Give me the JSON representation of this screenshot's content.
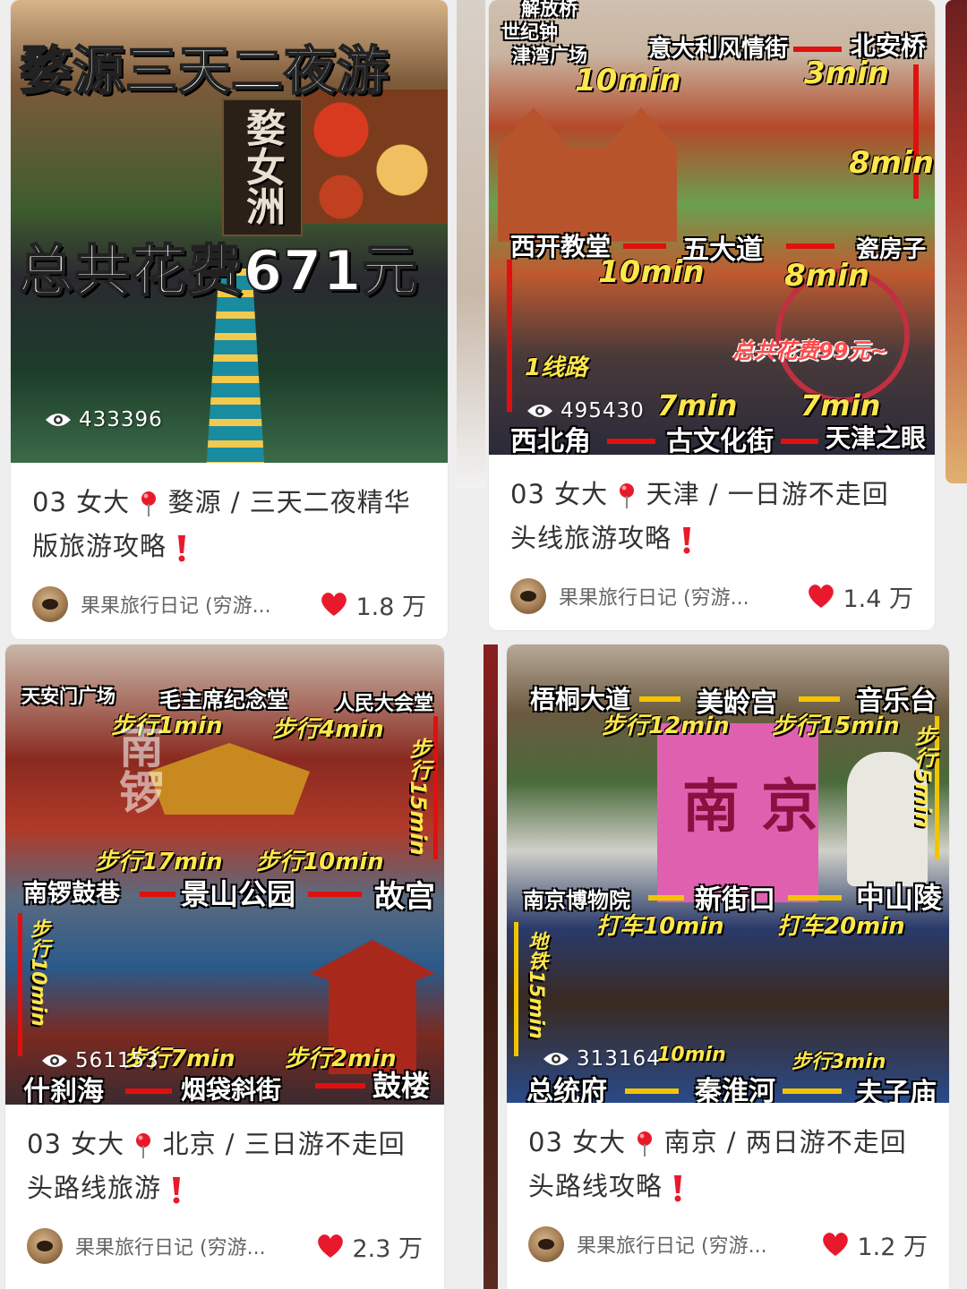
{
  "colors": {
    "heart": "#e8192c",
    "text": "#333333",
    "muted": "#666666",
    "cover_accent": "#ffe64a",
    "route_arrow": "#e01010"
  },
  "cards": [
    {
      "cover": {
        "title_line1": "婺源三天二夜游",
        "title_line2": "总共花费671元",
        "sign_text": "婺女洲",
        "views": "433396"
      },
      "title": "03 女大",
      "title_rest": "婺源 / 三天二夜精华版旅游攻略",
      "author": "果果旅行日记 (穷游...",
      "likes": "1.8 万"
    },
    {
      "cover": {
        "top_places": [
          "解放桥",
          "世纪钟",
          "津湾广场",
          "意大利风情街",
          "北安桥"
        ],
        "mid_places": [
          "西开教堂",
          "五大道",
          "瓷房子"
        ],
        "bottom_places": [
          "西北角",
          "古文化街",
          "天津之眼"
        ],
        "times": [
          "10min",
          "3min",
          "8min",
          "10min",
          "8min",
          "7min",
          "7min"
        ],
        "line_label": "1线路",
        "cost": "总共花费99元~",
        "views": "495430"
      },
      "title": "03 女大",
      "title_rest": "天津 / 一日游不走回头线旅游攻略",
      "author": "果果旅行日记 (穷游...",
      "likes": "1.4 万"
    },
    {
      "cover": {
        "top_places": [
          "天安门广场",
          "毛主席纪念堂",
          "人民大会堂"
        ],
        "top_times": [
          "步行1min",
          "步行4min"
        ],
        "right_time": "步行15min",
        "mid_times": [
          "步行17min",
          "步行10min"
        ],
        "mid_places": [
          "南锣鼓巷",
          "景山公园",
          "故宫"
        ],
        "left_time": "步行10min",
        "bottom_times": [
          "步行7min",
          "步行2min"
        ],
        "bottom_places": [
          "什刹海",
          "烟袋斜街",
          "鼓楼"
        ],
        "big_text": "南锣",
        "views": "561153"
      },
      "title": "03 女大",
      "title_rest": "北京 / 三日游不走回头路线旅游",
      "author": "果果旅行日记 (穷游...",
      "likes": "2.3 万"
    },
    {
      "cover": {
        "top_places": [
          "梧桐大道",
          "美龄宫",
          "音乐台"
        ],
        "top_times": [
          "步行12min",
          "步行15min"
        ],
        "right_time": "步行5min",
        "mid_places": [
          "南京博物院",
          "新街口",
          "中山陵"
        ],
        "mid_times": [
          "打车10min",
          "打车20min"
        ],
        "left_time": "地铁15min",
        "bottom_times": [
          "10min",
          "步行3min"
        ],
        "bottom_places": [
          "总统府",
          "秦淮河",
          "夫子庙"
        ],
        "big_text": "南京",
        "views": "313164"
      },
      "title": "03 女大",
      "title_rest": "南京 / 两日游不走回头路线攻略",
      "author": "果果旅行日记 (穷游...",
      "likes": "1.2 万"
    }
  ]
}
